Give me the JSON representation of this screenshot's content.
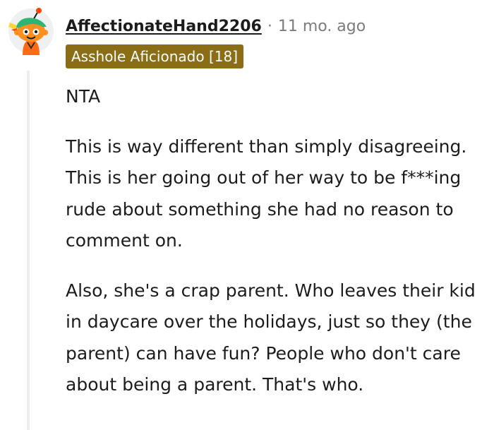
{
  "comment": {
    "username": "AffectionateHand2206",
    "separator": "·",
    "timestamp": "11 mo. ago",
    "flair": "Asshole Aficionado [18]",
    "avatar_icon": "reddit-snoo-avatar-icon",
    "colors": {
      "flair_bg": "#8a6d14",
      "flair_text": "#ffffff",
      "meta_text": "#7c7c7c",
      "body_text": "#1c1c1c",
      "thread_line": "#ededed"
    },
    "paragraphs": [
      "NTA",
      "This is way different than simply disagreeing. This is her going out of her way to be f***ing rude about something she had no reason to comment on.",
      "Also, she's a crap parent. Who leaves their kid in daycare over the holidays, just so they (the parent) can have fun? People who don't care about being a parent. That's who."
    ]
  }
}
